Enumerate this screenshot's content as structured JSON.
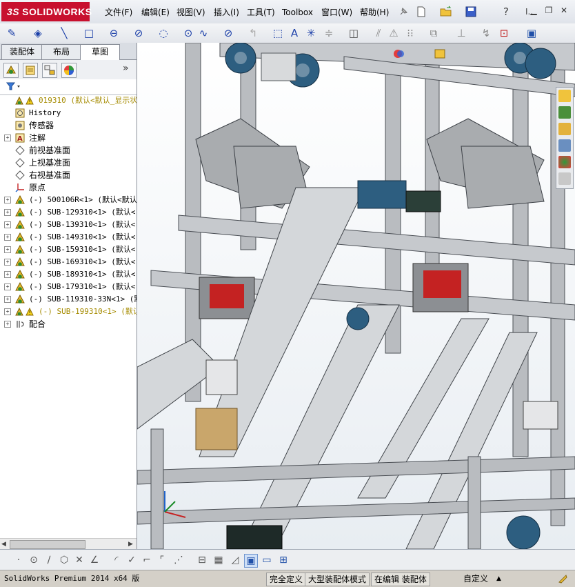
{
  "app": {
    "logo_text": "SOLIDWORKS",
    "logo_prefix": "3S"
  },
  "menu": [
    {
      "label": "文件(F)"
    },
    {
      "label": "编辑(E)"
    },
    {
      "label": "视图(V)"
    },
    {
      "label": "插入(I)"
    },
    {
      "label": "工具(T)"
    },
    {
      "label": "Toolbox"
    },
    {
      "label": "窗口(W)"
    },
    {
      "label": "帮助(H)"
    }
  ],
  "help_text": "?",
  "extra_text": "I..",
  "left_panel": {
    "tabs": [
      "装配体",
      "布局",
      "草图"
    ],
    "active_tab": "草图",
    "tree": [
      {
        "label": "019310  (默认<默认_显示状态",
        "icon": "assembly-warning-icon",
        "color": "#a58b00",
        "expandable": false
      },
      {
        "label": "History",
        "icon": "history-icon",
        "color": "#000000",
        "expandable": false
      },
      {
        "label": "传感器",
        "icon": "sensor-icon",
        "color": "#000000",
        "expandable": false
      },
      {
        "label": "注解",
        "icon": "annotation-icon",
        "color": "#000000",
        "expandable": true
      },
      {
        "label": "前视基准面",
        "icon": "plane-icon",
        "color": "#000000",
        "expandable": false
      },
      {
        "label": "上视基准面",
        "icon": "plane-icon",
        "color": "#000000",
        "expandable": false
      },
      {
        "label": "右视基准面",
        "icon": "plane-icon",
        "color": "#000000",
        "expandable": false
      },
      {
        "label": "原点",
        "icon": "origin-icon",
        "color": "#000000",
        "expandable": false
      },
      {
        "label": "(-) 500106R<1> (默认<默认_",
        "icon": "subassembly-icon",
        "color": "#000000",
        "expandable": true
      },
      {
        "label": "(-) SUB-129310<1> (默认<",
        "icon": "subassembly-icon",
        "color": "#000000",
        "expandable": true
      },
      {
        "label": "(-) SUB-139310<1> (默认<",
        "icon": "subassembly-icon",
        "color": "#000000",
        "expandable": true
      },
      {
        "label": "(-) SUB-149310<1> (默认<",
        "icon": "subassembly-icon",
        "color": "#000000",
        "expandable": true
      },
      {
        "label": "(-) SUB-159310<1> (默认<",
        "icon": "subassembly-icon",
        "color": "#000000",
        "expandable": true
      },
      {
        "label": "(-) SUB-169310<1> (默认<",
        "icon": "subassembly-icon",
        "color": "#000000",
        "expandable": true
      },
      {
        "label": "(-) SUB-189310<1> (默认<",
        "icon": "subassembly-icon",
        "color": "#000000",
        "expandable": true
      },
      {
        "label": "(-) SUB-179310<1> (默认<",
        "icon": "subassembly-icon",
        "color": "#000000",
        "expandable": true
      },
      {
        "label": "(-) SUB-119310-33N<1> (默认",
        "icon": "subassembly-icon",
        "color": "#000000",
        "expandable": true
      },
      {
        "label": "(-) SUB-199310<1> (默认",
        "icon": "subassembly-warning-icon",
        "color": "#a58b00",
        "expandable": true
      },
      {
        "label": "配合",
        "icon": "mates-icon",
        "color": "#000000",
        "expandable": true
      }
    ]
  },
  "status_bar": {
    "product": "SolidWorks Premium 2014 x64 版",
    "definition": "完全定义",
    "mode": "大型装配体模式",
    "editing": "在编辑 装配体",
    "units": "自定义",
    "units_arrow": "▲"
  }
}
